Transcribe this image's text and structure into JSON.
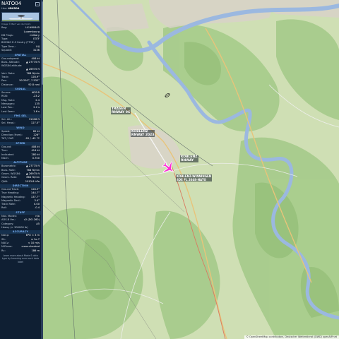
{
  "header": {
    "callsign": "NATO04",
    "hex_label": "Hex:",
    "hex_value": "4D03D4",
    "pin_label": "−"
  },
  "photo_credit": "Image © Bart van der Kolm",
  "info": [
    {
      "k": "Reg:",
      "v": "LX-N90445"
    },
    {
      "k": "",
      "v": "Luxembourg"
    },
    {
      "k": "DB Flags:",
      "v": "military"
    },
    {
      "k": "Type:",
      "v": "E3TF"
    },
    {
      "k": "BOEING E-3 Sentry (TF33)",
      "v": ""
    },
    {
      "k": "Type Desc.:",
      "v": "L4J"
    },
    {
      "k": "Squawk:",
      "v": "3136"
    }
  ],
  "spatial_title": "SPATIAL",
  "spatial": [
    {
      "k": "Groundspeed:",
      "v": "408 kt"
    },
    {
      "k": "Baro. Altitude:",
      "v": "▲ 27775 ft"
    },
    {
      "k": "WGS84 altitude:",
      "v": ""
    }
  ],
  "spatial_geo": "▲ 26975 ft",
  "spatial2": [
    {
      "k": "Vert. Rate:",
      "v": "768 ft/min"
    },
    {
      "k": "Track:",
      "v": "128.9°"
    },
    {
      "k": "Pos.:",
      "v": "50.250°, 7.532°"
    },
    {
      "k": "Distance:",
      "v": "92.8 nmi"
    }
  ],
  "signal_title": "SIGNAL",
  "signal": [
    {
      "k": "Source:",
      "v": "ADS-B"
    },
    {
      "k": "RSSI:",
      "v": "-23.2"
    },
    {
      "k": "Msg. Rate:",
      "v": "2.4"
    },
    {
      "k": "Messages:",
      "v": "135"
    },
    {
      "k": "Last Pos.:",
      "v": "2.2 s"
    },
    {
      "k": "Last Seen:",
      "v": "1.6 s"
    }
  ],
  "fms_title": "FMS SEL",
  "fms": [
    {
      "k": "Sel. Alt.:",
      "v": "31008 ft"
    },
    {
      "k": "Sel. Head.:",
      "v": "127.5°"
    }
  ],
  "wind_title": "WIND",
  "wind": [
    {
      "k": "Speed:",
      "v": "82 kt"
    },
    {
      "k": "Direction (from):",
      "v": "226°"
    },
    {
      "k": "TAT / OAT:",
      "v": "-20 / -45 °C"
    }
  ],
  "speed_title": "SPEED",
  "speed": [
    {
      "k": "Ground:",
      "v": "408 kt"
    },
    {
      "k": "True:",
      "v": "414 kt"
    },
    {
      "k": "Indicated:",
      "v": "280 kt"
    },
    {
      "k": "Mach:",
      "v": "0.700"
    }
  ],
  "altitude_title": "ALTITUDE",
  "altitude": [
    {
      "k": "Barometric:",
      "v": "▲ 27775 ft"
    },
    {
      "k": "Baro. Rate:",
      "v": "768 ft/min"
    },
    {
      "k": "Geom. WGS84:",
      "v": "▲ 26975 ft"
    },
    {
      "k": "Geom. Rate:",
      "v": "864 ft/min"
    },
    {
      "k": "QNH:",
      "v": "1013.8 hPa"
    }
  ],
  "direction_title": "DIRECTION",
  "direction": [
    {
      "k": "Ground Track:",
      "v": "128.9°"
    },
    {
      "k": "True Heading:",
      "v": "144.7°"
    },
    {
      "k": "Magnetic Heading:",
      "v": "137.7°"
    },
    {
      "k": "Magnetic Decl.:",
      "v": "3.4°"
    },
    {
      "k": "Track Rate:",
      "v": "0.00"
    },
    {
      "k": "Roll:",
      "v": "-0.4"
    }
  ],
  "stuff_title": "STUFF",
  "stuff": [
    {
      "k": "Nav. Modes:",
      "v": "n/a"
    },
    {
      "k": "ADS-B Ver.:",
      "v": "v2 (DO-260)"
    },
    {
      "k": "Category:",
      "v": "A5"
    },
    {
      "k": "Heavy (> 300000 lb)",
      "v": ""
    }
  ],
  "accuracy_title": "ACCURACY",
  "accuracy": [
    {
      "k": "NACp:",
      "v": "EPU < 3 m"
    },
    {
      "k": "SIL:",
      "v": "≤ 1e-7"
    },
    {
      "k": "NACv:",
      "v": "< 10 m/s"
    },
    {
      "k": "NICbaro:",
      "v": "cross-checked"
    },
    {
      "k": "Rc:",
      "v": "186 m"
    }
  ],
  "footer": "Learn more about Mode S data type by hovering over each data label",
  "map": {
    "labels": {
      "waypoint_a": "TRASEN\nRNWAY 96",
      "waypoint_b": "KOBLENZ\nRNWAY 2023",
      "waypoint_c": "KOBLENZ\nRNWAY",
      "waypoint_d": "KOBLENZ-WINNINGEN\n8DE FL 2048-NATO"
    },
    "attribution": "© OpenStreetMap contributors, Deutscher Wetterdienst (DWD) openAIP.net"
  },
  "colors": {
    "panel_bg": "#0f1f33",
    "section_accent": "#7fb7ff",
    "aircraft": "#ff2bd6",
    "river": "#9bb8e0",
    "forest": "#9fc585"
  }
}
